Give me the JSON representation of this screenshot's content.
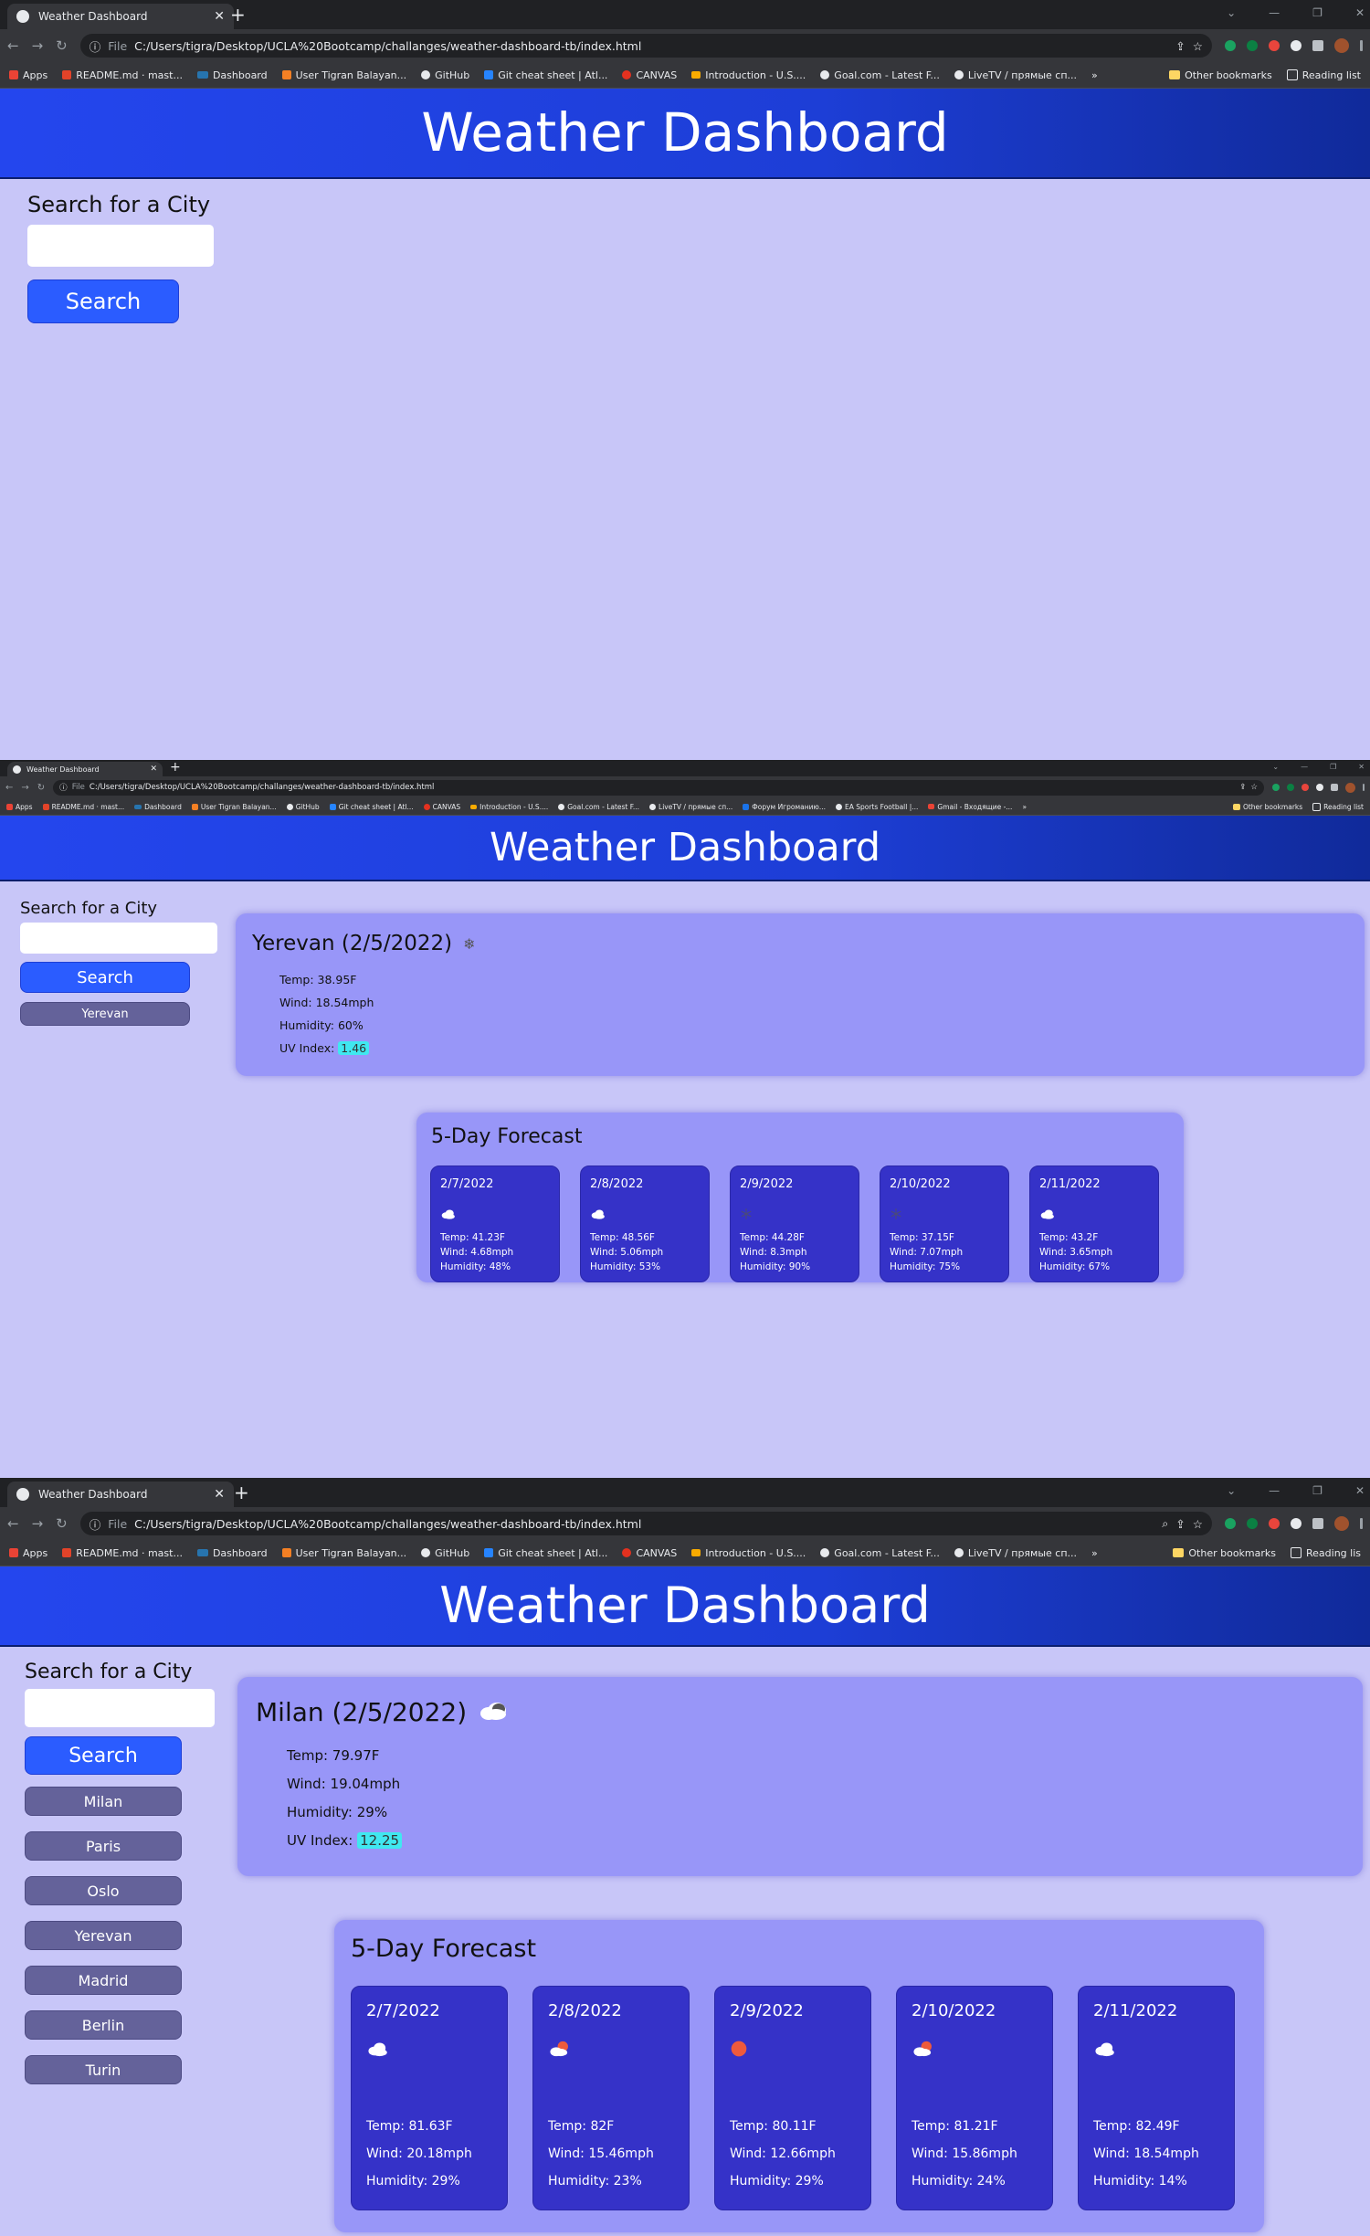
{
  "browser": {
    "tab_title": "Weather Dashboard",
    "file_label": "File",
    "url": "C:/Users/tigra/Desktop/UCLA%20Bootcamp/challanges/weather-dashboard-tb/index.html",
    "bookmarks_a": [
      "Apps",
      "README.md · mast...",
      "Dashboard",
      "User Tigran Balayan...",
      "GitHub",
      "Git cheat sheet | Atl...",
      "CANVAS",
      "Introduction - U.S....",
      "Goal.com - Latest F...",
      "LiveTV / прямые сп..."
    ],
    "bookmarks_b": [
      "Apps",
      "README.md · mast...",
      "Dashboard",
      "User Tigran Balayan...",
      "GitHub",
      "Git cheat sheet | Atl...",
      "CANVAS",
      "Introduction - U.S....",
      "Goal.com - Latest F...",
      "LiveTV / прямые сп...",
      "Форум Игроманию...",
      "EA Sports Football |...",
      "Gmail - Входящие -..."
    ],
    "overflow": "»",
    "other_bookmarks": "Other bookmarks",
    "reading_list": "Reading list",
    "reading_list_cut": "Reading lis"
  },
  "app": {
    "title": "Weather Dashboard",
    "search_label": "Search for a City",
    "search_button": "Search",
    "forecast_title": "5-Day Forecast"
  },
  "shot2": {
    "history": [
      "Yerevan"
    ],
    "current": {
      "heading": "Yerevan (2/5/2022)",
      "icon": "snowflake-icon",
      "temp": "Temp: 38.95F",
      "wind": "Wind: 18.54mph",
      "humidity": "Humidity: 60%",
      "uv_label": "UV Index:",
      "uv_value": "1.46"
    },
    "forecast": [
      {
        "date": "2/7/2022",
        "icon": "cloud-icon",
        "temp": "Temp: 41.23F",
        "wind": "Wind: 4.68mph",
        "humidity": "Humidity: 48%"
      },
      {
        "date": "2/8/2022",
        "icon": "cloud-icon",
        "temp": "Temp: 48.56F",
        "wind": "Wind: 5.06mph",
        "humidity": "Humidity: 53%"
      },
      {
        "date": "2/9/2022",
        "icon": "snowflake-icon",
        "temp": "Temp: 44.28F",
        "wind": "Wind: 8.3mph",
        "humidity": "Humidity: 90%"
      },
      {
        "date": "2/10/2022",
        "icon": "snowflake-icon",
        "temp": "Temp: 37.15F",
        "wind": "Wind: 7.07mph",
        "humidity": "Humidity: 75%"
      },
      {
        "date": "2/11/2022",
        "icon": "cloud-icon",
        "temp": "Temp: 43.2F",
        "wind": "Wind: 3.65mph",
        "humidity": "Humidity: 67%"
      }
    ]
  },
  "shot3": {
    "history": [
      "Milan",
      "Paris",
      "Oslo",
      "Yerevan",
      "Madrid",
      "Berlin",
      "Turin"
    ],
    "current": {
      "heading": "Milan (2/5/2022)",
      "icon": "cloud-icon",
      "temp": "Temp: 79.97F",
      "wind": "Wind: 19.04mph",
      "humidity": "Humidity: 29%",
      "uv_label": "UV Index:",
      "uv_value": "12.25"
    },
    "forecast": [
      {
        "date": "2/7/2022",
        "icon": "cloud-icon",
        "temp": "Temp: 81.63F",
        "wind": "Wind: 20.18mph",
        "humidity": "Humidity: 29%"
      },
      {
        "date": "2/8/2022",
        "icon": "sun-cloud-icon",
        "temp": "Temp: 82F",
        "wind": "Wind: 15.46mph",
        "humidity": "Humidity: 23%"
      },
      {
        "date": "2/9/2022",
        "icon": "sun-icon",
        "temp": "Temp: 80.11F",
        "wind": "Wind: 12.66mph",
        "humidity": "Humidity: 29%"
      },
      {
        "date": "2/10/2022",
        "icon": "sun-cloud-icon",
        "temp": "Temp: 81.21F",
        "wind": "Wind: 15.86mph",
        "humidity": "Humidity: 24%"
      },
      {
        "date": "2/11/2022",
        "icon": "cloud-icon",
        "temp": "Temp: 82.49F",
        "wind": "Wind: 18.54mph",
        "humidity": "Humidity: 14%"
      }
    ]
  }
}
